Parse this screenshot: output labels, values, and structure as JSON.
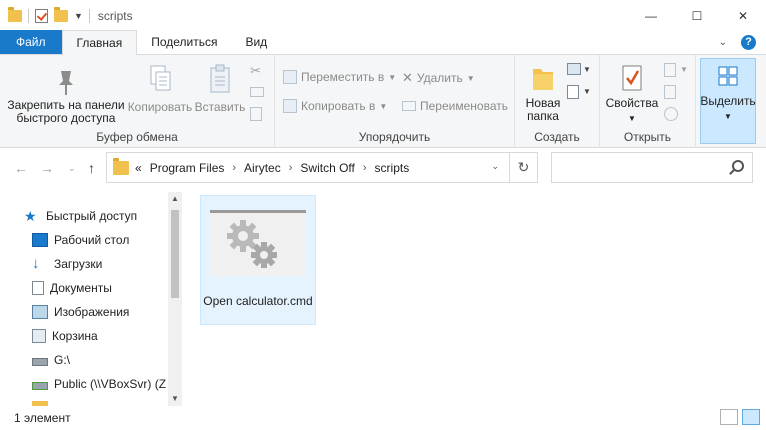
{
  "window": {
    "title": "scripts",
    "minimize": "—",
    "maximize": "☐",
    "close": "✕"
  },
  "tabs": [
    {
      "label": "Файл"
    },
    {
      "label": "Главная"
    },
    {
      "label": "Поделиться"
    },
    {
      "label": "Вид"
    }
  ],
  "ribbon": {
    "clipboard": {
      "label": "Буфер обмена",
      "pin": "Закрепить на панели быстрого доступа",
      "copy": "Копировать",
      "paste": "Вставить"
    },
    "organize": {
      "label": "Упорядочить",
      "move_to": "Переместить в",
      "copy_to": "Копировать в",
      "delete": "Удалить",
      "rename": "Переименовать"
    },
    "new": {
      "label": "Создать",
      "new_folder": "Новая папка"
    },
    "open": {
      "label": "Открыть",
      "properties": "Свойства"
    },
    "select": {
      "label": "Выделить"
    }
  },
  "address": {
    "prefix": "«",
    "crumbs": [
      "Program Files",
      "Airytec",
      "Switch Off",
      "scripts"
    ]
  },
  "search": {
    "placeholder": ""
  },
  "nav": {
    "items": [
      {
        "label": "Быстрый доступ",
        "icon": "star-icon"
      },
      {
        "label": "Рабочий стол",
        "icon": "desktop-icon",
        "pinned": true
      },
      {
        "label": "Загрузки",
        "icon": "download-icon",
        "pinned": true
      },
      {
        "label": "Документы",
        "icon": "documents-icon",
        "pinned": true
      },
      {
        "label": "Изображения",
        "icon": "pictures-icon",
        "pinned": true
      },
      {
        "label": "Корзина",
        "icon": "recycle-bin-icon",
        "pinned": true
      },
      {
        "label": "G:\\",
        "icon": "drive-icon",
        "pinned": true
      },
      {
        "label": "Public (\\\\VBoxSvr) (Z",
        "icon": "network-drive-icon",
        "pinned": false
      }
    ]
  },
  "content": {
    "files": [
      {
        "name": "Open calculator.cmd",
        "icon": "cmd-gear-icon"
      }
    ]
  },
  "status": {
    "count": "1 элемент"
  },
  "colors": {
    "accent": "#1979ca",
    "selection": "#e5f3ff",
    "ribbon_bg": "#f5f6f7"
  }
}
